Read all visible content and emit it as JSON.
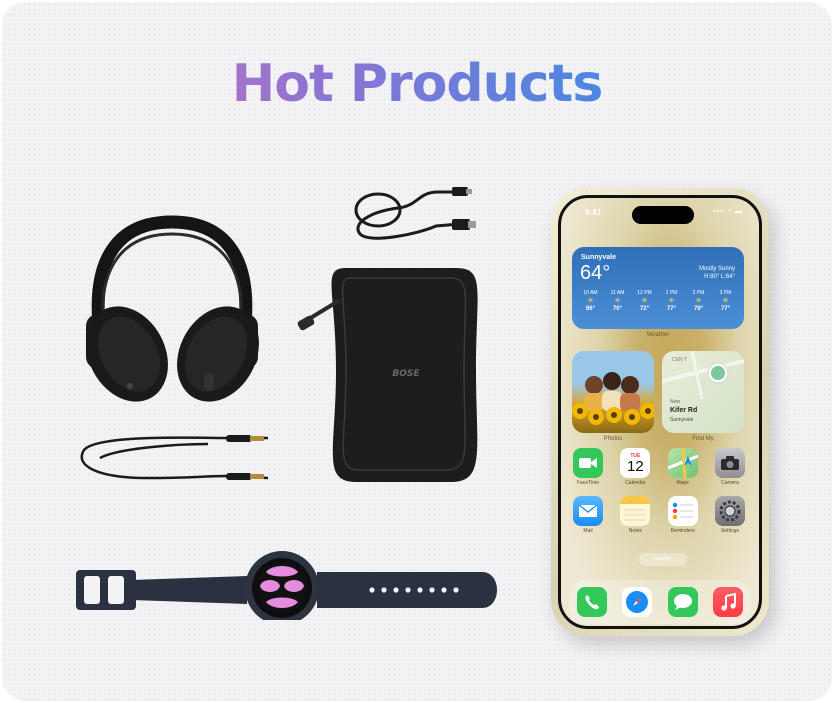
{
  "heading": {
    "title": "Hot Products",
    "gradient": [
      "#d477b4",
      "#8a74d4",
      "#2a8fe8"
    ]
  },
  "products": [
    {
      "name": "headphones",
      "color": "#1e1e1f"
    },
    {
      "name": "usb-cable",
      "color": "#1e1e1f"
    },
    {
      "name": "audio-cable",
      "color": "#1e1e1f"
    },
    {
      "name": "carrying-case",
      "brand": "BOSE",
      "color": "#1c1c1d"
    },
    {
      "name": "smartwatch",
      "band_color": "#2a3140",
      "dial_color": "#e58be0"
    }
  ],
  "phone": {
    "status": {
      "time": "9:41",
      "icons": "▪▪▪ ◔ ▬"
    },
    "weather": {
      "city": "Sunnyvale",
      "temp": "64°",
      "condition": "Mostly Sunny",
      "high_low": "H:80° L:64°",
      "hours": [
        {
          "time": "10 AM",
          "temp": "66°"
        },
        {
          "time": "11 AM",
          "temp": "70°"
        },
        {
          "time": "12 PM",
          "temp": "72°"
        },
        {
          "time": "1 PM",
          "temp": "77°"
        },
        {
          "time": "2 PM",
          "temp": "79°"
        },
        {
          "time": "3 PM",
          "temp": "77°"
        }
      ],
      "label": "Weather"
    },
    "photos": {
      "label": "Photos"
    },
    "findmy": {
      "now": "Now",
      "street": "Kifer Rd",
      "city": "Sunnyvale",
      "label": "Find My",
      "map_label": "CEN T"
    },
    "apps": [
      [
        {
          "name": "FaceTime",
          "icon": "facetime-icon",
          "color": "#34c759"
        },
        {
          "name": "Calendar",
          "icon": "calendar-icon",
          "color": "#ffffff",
          "day": "TUE",
          "date": "12"
        },
        {
          "name": "Maps",
          "icon": "maps-icon",
          "color": "#6ec170"
        },
        {
          "name": "Camera",
          "icon": "camera-icon",
          "color": "#8e8e93"
        }
      ],
      [
        {
          "name": "Mail",
          "icon": "mail-icon",
          "color": "#1b8cf5"
        },
        {
          "name": "Notes",
          "icon": "notes-icon",
          "color": "#fff6d6"
        },
        {
          "name": "Reminders",
          "icon": "reminders-icon",
          "color": "#ffffff"
        },
        {
          "name": "Settings",
          "icon": "settings-icon",
          "color": "#8e8e93"
        }
      ]
    ],
    "search": "Search",
    "dock": [
      {
        "name": "Phone",
        "icon": "phone-icon",
        "color": "#34c759"
      },
      {
        "name": "Safari",
        "icon": "safari-icon",
        "color": "#1b8cf5"
      },
      {
        "name": "Messages",
        "icon": "messages-icon",
        "color": "#34c759"
      },
      {
        "name": "Music",
        "icon": "music-icon",
        "color": "#fc3c44"
      }
    ]
  }
}
